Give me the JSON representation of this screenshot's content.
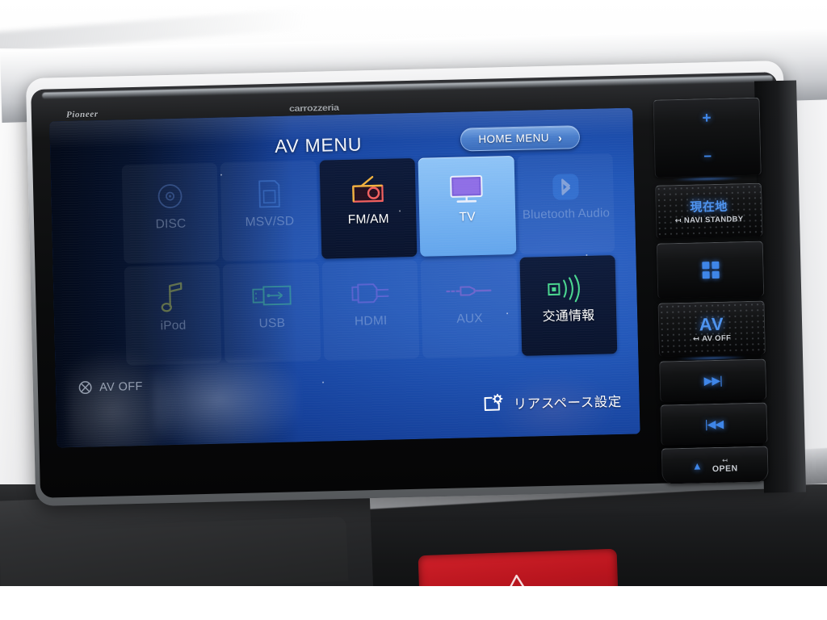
{
  "device": {
    "brand_left": "Pioneer",
    "brand_center": "carrozzeria"
  },
  "screen": {
    "title": "AV MENU",
    "home_menu": {
      "label": "HOME MENU",
      "chevron": "›",
      "icon": "chevron-right-icon"
    },
    "av_off": {
      "label": "AV OFF",
      "icon": "av-off-icon"
    },
    "rear_space": {
      "label": "リアスペース設定",
      "icon": "screen-settings-icon"
    },
    "tiles": [
      {
        "id": "disc",
        "label": "DISC",
        "icon": "disc-icon",
        "state": "disabled",
        "icon_color": "#5b82c8"
      },
      {
        "id": "msv-sd",
        "label": "MSV/SD",
        "icon": "sd-card-icon",
        "state": "disabled",
        "icon_color": "#4f8ce8"
      },
      {
        "id": "fm-am",
        "label": "FM/AM",
        "icon": "radio-icon",
        "state": "enabled",
        "icon_color": "#f2a63c"
      },
      {
        "id": "tv",
        "label": "TV",
        "icon": "tv-icon",
        "state": "selected",
        "icon_color": "#7a5cd6"
      },
      {
        "id": "bluetooth",
        "label": "Bluetooth Audio",
        "icon": "bluetooth-icon",
        "state": "disabled",
        "icon_color": "#3f86e8"
      },
      {
        "id": "ipod",
        "label": "iPod",
        "icon": "music-note-icon",
        "state": "disabled",
        "icon_color": "#c9d44a"
      },
      {
        "id": "usb",
        "label": "USB",
        "icon": "usb-icon",
        "state": "disabled",
        "icon_color": "#4ad68f"
      },
      {
        "id": "hdmi",
        "label": "HDMI",
        "icon": "hdmi-icon",
        "state": "disabled",
        "icon_color": "#9b6df0"
      },
      {
        "id": "aux",
        "label": "AUX",
        "icon": "aux-jack-icon",
        "state": "disabled",
        "icon_color": "#c36ce0"
      },
      {
        "id": "traffic",
        "label": "交通情報",
        "icon": "broadcast-icon",
        "state": "enabled",
        "icon_color": "#4ad68f"
      }
    ]
  },
  "hardware_buttons": {
    "volume": {
      "plus": "+",
      "minus": "−",
      "name": "volume-rocker"
    },
    "navi": {
      "label": "現在地",
      "sub": "NAVI STANDBY",
      "arrow": "↤"
    },
    "menu_grid": {
      "name": "grid-menu-button"
    },
    "av": {
      "label": "AV",
      "sub": "AV OFF",
      "arrow": "↤"
    },
    "next": {
      "glyph": "▶▶|",
      "name": "next-track-button"
    },
    "prev": {
      "glyph": "|◀◀",
      "name": "prev-track-button"
    },
    "open": {
      "eject": "▲",
      "label": "OPEN",
      "arrow": "↤"
    }
  },
  "dashboard": {
    "hazard_button": {
      "icon": "hazard-triangle-icon"
    }
  },
  "colors": {
    "screen_blue": "#2257b8",
    "selected_tile": "#79b5f2",
    "button_glow": "#3f86e8",
    "hazard_red": "#b9151e"
  }
}
